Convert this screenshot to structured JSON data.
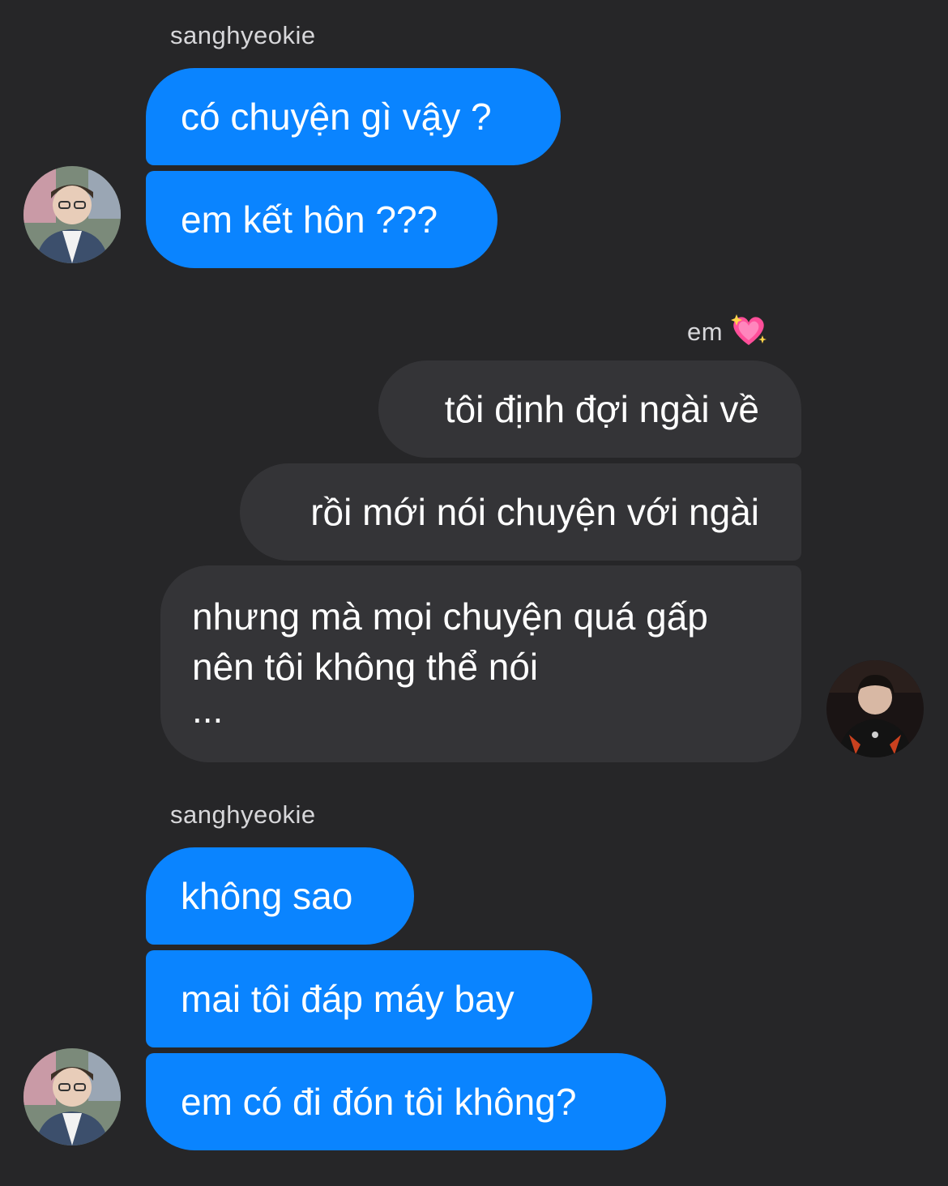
{
  "conversation": {
    "group1": {
      "sender": "sanghyeokie",
      "messages": [
        "có chuyện gì vậy ?",
        "em kết hôn ???"
      ]
    },
    "group2": {
      "sender": "em",
      "sender_icon": "sparkling-heart-icon",
      "messages": [
        "tôi định đợi ngài về",
        "rồi mới nói chuyện với ngài",
        "nhưng mà mọi chuyện quá gấp",
        "nên tôi không thể nói",
        "..."
      ]
    },
    "group3": {
      "sender": "sanghyeokie",
      "messages": [
        "không sao",
        "mai tôi đáp máy bay",
        "em có đi đón tôi không?"
      ]
    }
  },
  "colors": {
    "background": "#262628",
    "incoming_bubble": "#0a84ff",
    "outgoing_bubble": "#343437",
    "sender_name": "#d7d7da"
  }
}
